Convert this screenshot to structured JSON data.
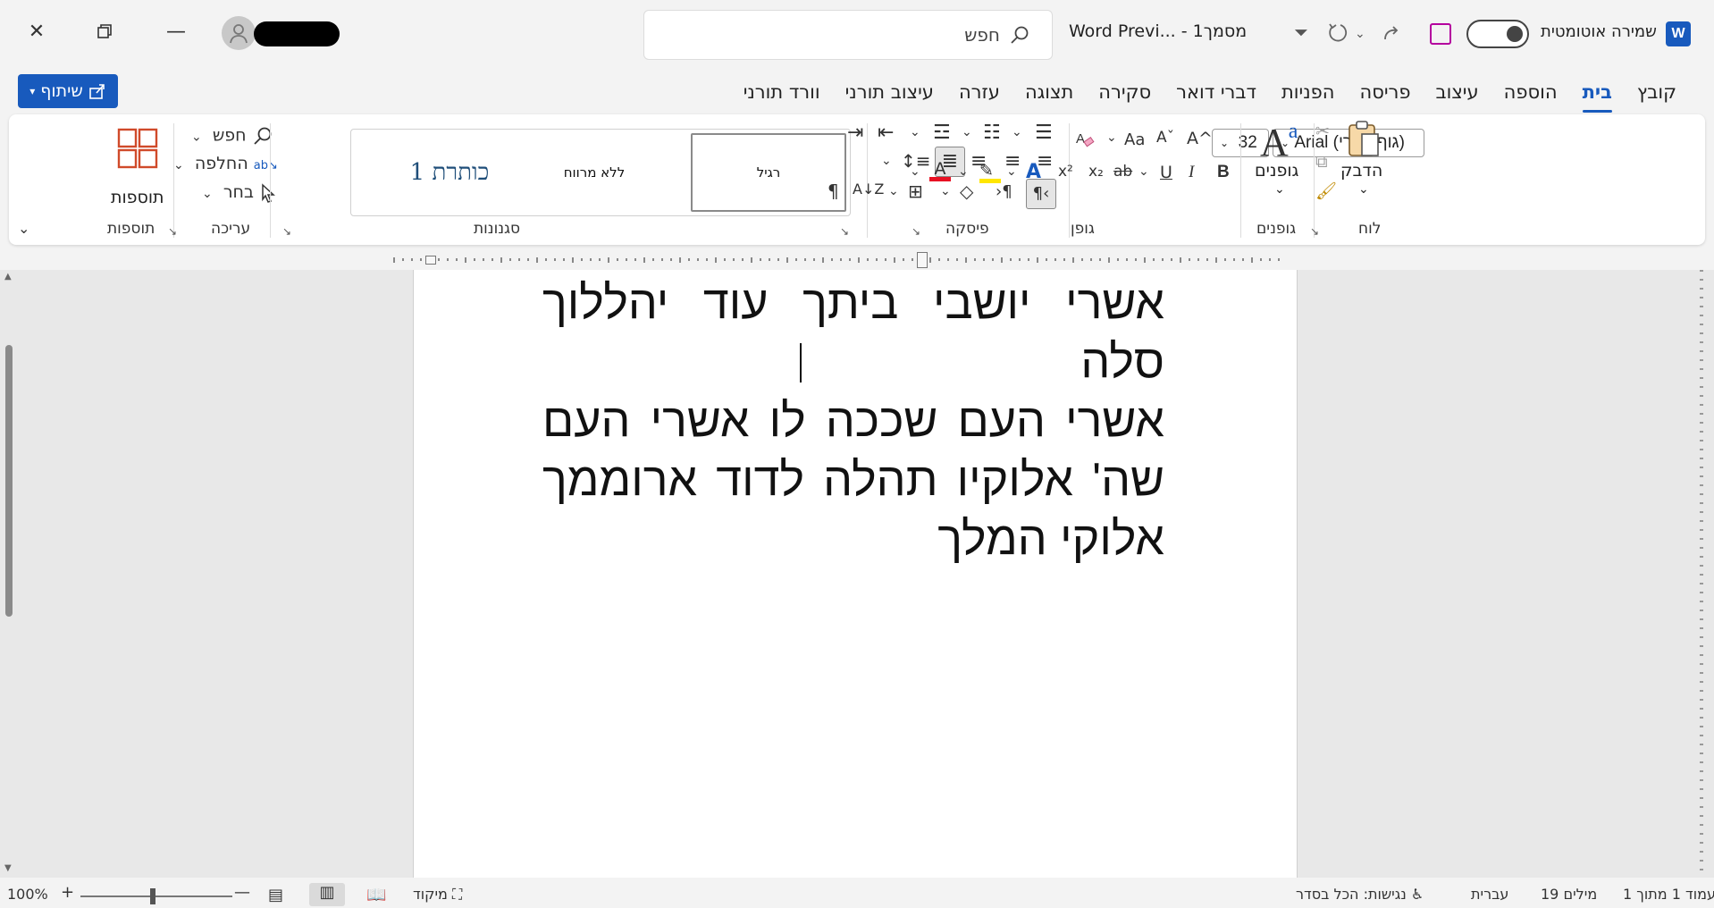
{
  "titlebar": {
    "search_placeholder": "חפש",
    "doc_title": "Word Previ...  -  מסמך1",
    "autosave_label": "שמירה אוטומטית",
    "word_logo": "W"
  },
  "ribbon_tabs": {
    "share_label": "שיתוף",
    "tabs": [
      {
        "label": "קובץ"
      },
      {
        "label": "בית"
      },
      {
        "label": "הוספה"
      },
      {
        "label": "עיצוב"
      },
      {
        "label": "פריסה"
      },
      {
        "label": "הפניות"
      },
      {
        "label": "דברי דואר"
      },
      {
        "label": "סקירה"
      },
      {
        "label": "תצוגה"
      },
      {
        "label": "עזרה"
      },
      {
        "label": "עיצוב תורני"
      },
      {
        "label": "וורד תורני"
      }
    ],
    "active_tab": "בית"
  },
  "ribbon": {
    "clipboard": {
      "paste_label": "הדבק",
      "group_label": "לוח"
    },
    "themes": {
      "big_icon": "A",
      "label": "גופנים",
      "group_label": "גופנים"
    },
    "font": {
      "font_name": "Arial (גוף עברי)",
      "font_size": "32",
      "group_label": "גופן",
      "bold": "B",
      "italic": "I",
      "underline": "U",
      "strike": "ab",
      "subscript": "x₂",
      "superscript": "x²",
      "grow": "A^",
      "shrink": "Aˇ",
      "case": "Aa",
      "text_effects": "A",
      "font_color": "A"
    },
    "paragraph": {
      "group_label": "פיסקה",
      "pilcrow": "¶"
    },
    "styles": {
      "group_label": "סגנונות",
      "items": [
        {
          "label": "רגיל"
        },
        {
          "label": "ללא מרווח"
        },
        {
          "label": "כותרת 1"
        }
      ]
    },
    "editing": {
      "group_label": "עריכה",
      "find": "חפש",
      "replace": "החלפה",
      "select": "בחר"
    },
    "addins": {
      "label": "תוספות",
      "group_label": "תוספות"
    }
  },
  "document": {
    "lines": [
      "אשרי יושבי ביתך עוד יהללוך סלה",
      "אשרי העם שככה לו אשרי העם",
      "שה' אלוקיו תהלה לדוד ארוממך",
      "אלוקי המלך"
    ]
  },
  "statusbar": {
    "page_info": "עמוד 1 מתוך 1",
    "word_count": "19 מילים",
    "language": "עברית",
    "accessibility": "נגישות: הכל בסדר",
    "focus": "מיקוד",
    "zoom": "100%"
  },
  "colors": {
    "accent": "#185abd",
    "font_color_bar": "#e81123",
    "highlight_bar": "#ffe600",
    "addins_icon": "#d04a2a"
  }
}
